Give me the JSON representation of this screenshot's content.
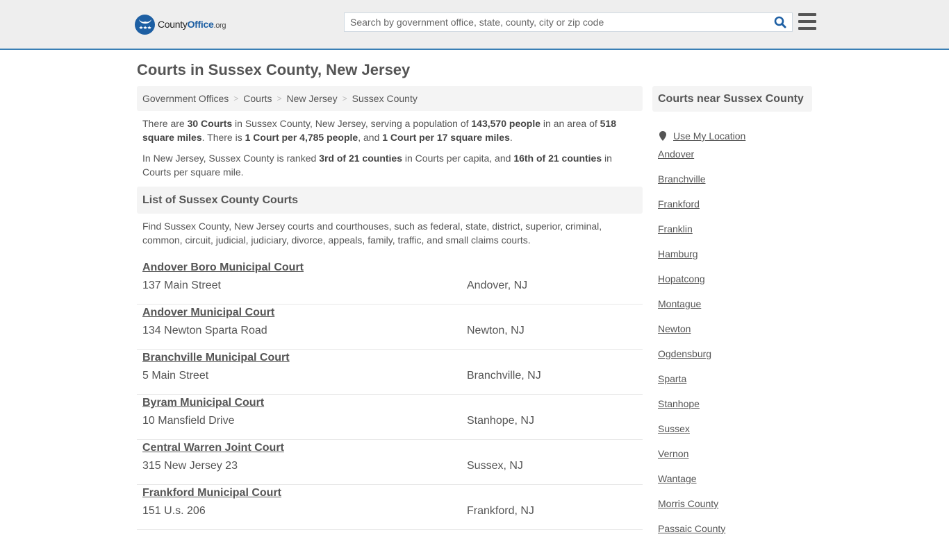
{
  "header": {
    "logo": {
      "name_main": "County",
      "name_accent": "Office",
      "name_suffix": ".org"
    },
    "search": {
      "placeholder": "Search by government office, state, county, city or zip code",
      "value": ""
    },
    "icons": {
      "search": "search-icon",
      "menu": "hamburger-menu-icon"
    },
    "colors": {
      "brand": "#1d5fa3",
      "header_bg": "#eeeeee",
      "header_border": "#3a7fb5"
    }
  },
  "page": {
    "title": "Courts in Sussex County, New Jersey"
  },
  "breadcrumb": [
    {
      "label": "Government Offices"
    },
    {
      "label": "Courts"
    },
    {
      "label": "New Jersey"
    },
    {
      "label": "Sussex County"
    }
  ],
  "breadcrumb_separator": ">",
  "intro": {
    "p1": {
      "t1": "There are ",
      "b1": "30 Courts",
      "t2": " in Sussex County, New Jersey, serving a population of ",
      "b2": "143,570 people",
      "t3": " in an area of ",
      "b3": "518 square miles",
      "t4": ". There is ",
      "b4": "1 Court per 4,785 people",
      "t5": ", and ",
      "b5": "1 Court per 17 square miles",
      "t6": "."
    },
    "p2": {
      "t1": "In New Jersey, Sussex County is ranked ",
      "b1": "3rd of 21 counties",
      "t2": " in Courts per capita, and ",
      "b2": "16th of 21 counties",
      "t3": " in Courts per square mile."
    }
  },
  "list_section": {
    "title": "List of Sussex County Courts",
    "description": "Find Sussex County, New Jersey courts and courthouses, such as federal, state, district, superior, criminal, common, circuit, judicial, judiciary, divorce, appeals, family, traffic, and small claims courts."
  },
  "courts": [
    {
      "name": "Andover Boro Municipal Court",
      "address": "137 Main Street",
      "city": "Andover, NJ"
    },
    {
      "name": "Andover Municipal Court",
      "address": "134 Newton Sparta Road",
      "city": "Newton, NJ"
    },
    {
      "name": "Branchville Municipal Court",
      "address": "5 Main Street",
      "city": "Branchville, NJ"
    },
    {
      "name": "Byram Municipal Court",
      "address": "10 Mansfield Drive",
      "city": "Stanhope, NJ"
    },
    {
      "name": "Central Warren Joint Court",
      "address": "315 New Jersey 23",
      "city": "Sussex, NJ"
    },
    {
      "name": "Frankford Municipal Court",
      "address": "151 U.s. 206",
      "city": "Frankford, NJ"
    }
  ],
  "sidebar": {
    "title": "Courts near Sussex County",
    "use_location": "Use My Location",
    "location_icon": "map-pin-icon",
    "links": [
      "Andover",
      "Branchville",
      "Frankford",
      "Franklin",
      "Hamburg",
      "Hopatcong",
      "Montague",
      "Newton",
      "Ogdensburg",
      "Sparta",
      "Stanhope",
      "Sussex",
      "Vernon",
      "Wantage",
      "Morris County",
      "Passaic County"
    ]
  }
}
